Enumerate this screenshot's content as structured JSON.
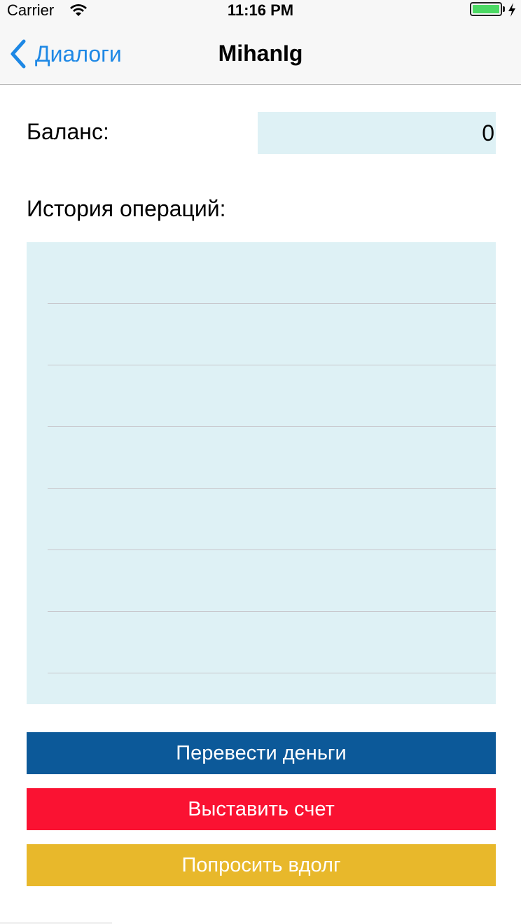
{
  "status_bar": {
    "carrier": "Carrier",
    "time": "11:16 PM",
    "battery_color": "#4cd964"
  },
  "nav": {
    "back_label": "Диалоги",
    "title": "MihanIg",
    "accent_color": "#1e88e5"
  },
  "balance": {
    "label": "Баланс:",
    "value": "0"
  },
  "history": {
    "label": "История операций:",
    "rows": [
      "",
      "",
      "",
      "",
      "",
      "",
      ""
    ]
  },
  "actions": {
    "transfer": {
      "label": "Перевести деньги",
      "color": "#0c5999"
    },
    "invoice": {
      "label": "Выставить счет",
      "color": "#fa1232"
    },
    "borrow": {
      "label": "Попросить вдолг",
      "color": "#e8b82b"
    }
  }
}
